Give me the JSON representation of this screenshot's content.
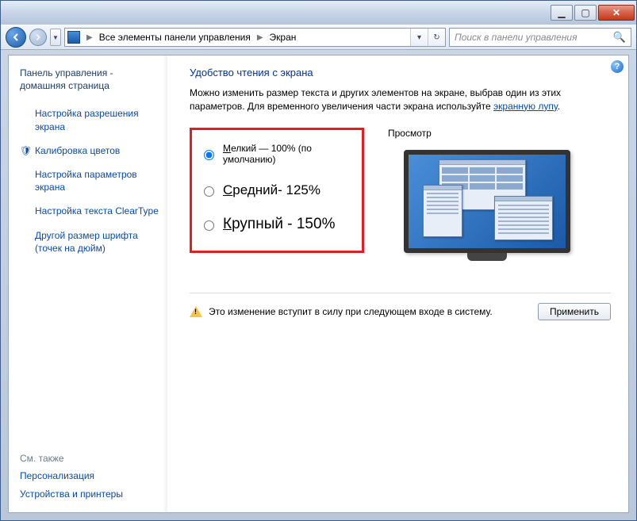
{
  "titlebar": {
    "minimize": "▁",
    "maximize": "▢",
    "close": "✕"
  },
  "breadcrumb": {
    "item1": "Все элементы панели управления",
    "item2": "Экран"
  },
  "search": {
    "placeholder": "Поиск в панели управления"
  },
  "sidebar": {
    "home_line1": "Панель управления -",
    "home_line2": "домашняя страница",
    "links": [
      "Настройка разрешения экрана",
      "Калибровка цветов",
      "Настройка параметров экрана",
      "Настройка текста ClearType",
      "Другой размер шрифта (точек на дюйм)"
    ],
    "see_also_title": "См. также",
    "see_also": [
      "Персонализация",
      "Устройства и принтеры"
    ]
  },
  "main": {
    "heading": "Удобство чтения с экрана",
    "desc_before": "Можно изменить размер текста и других элементов на экране, выбрав один из этих параметров. Для временного увеличения части экрана используйте ",
    "desc_link": "экранную лупу",
    "desc_after": ".",
    "radios": {
      "small_u": "М",
      "small_rest": "елкий — 100% (по умолчанию)",
      "medium_u": "С",
      "medium_rest": "редний- 125%",
      "large_u": "К",
      "large_rest": "рупный - 150%"
    },
    "preview_label": "Просмотр",
    "note": "Это изменение вступит в силу при следующем входе в систему.",
    "apply": "Применить"
  }
}
